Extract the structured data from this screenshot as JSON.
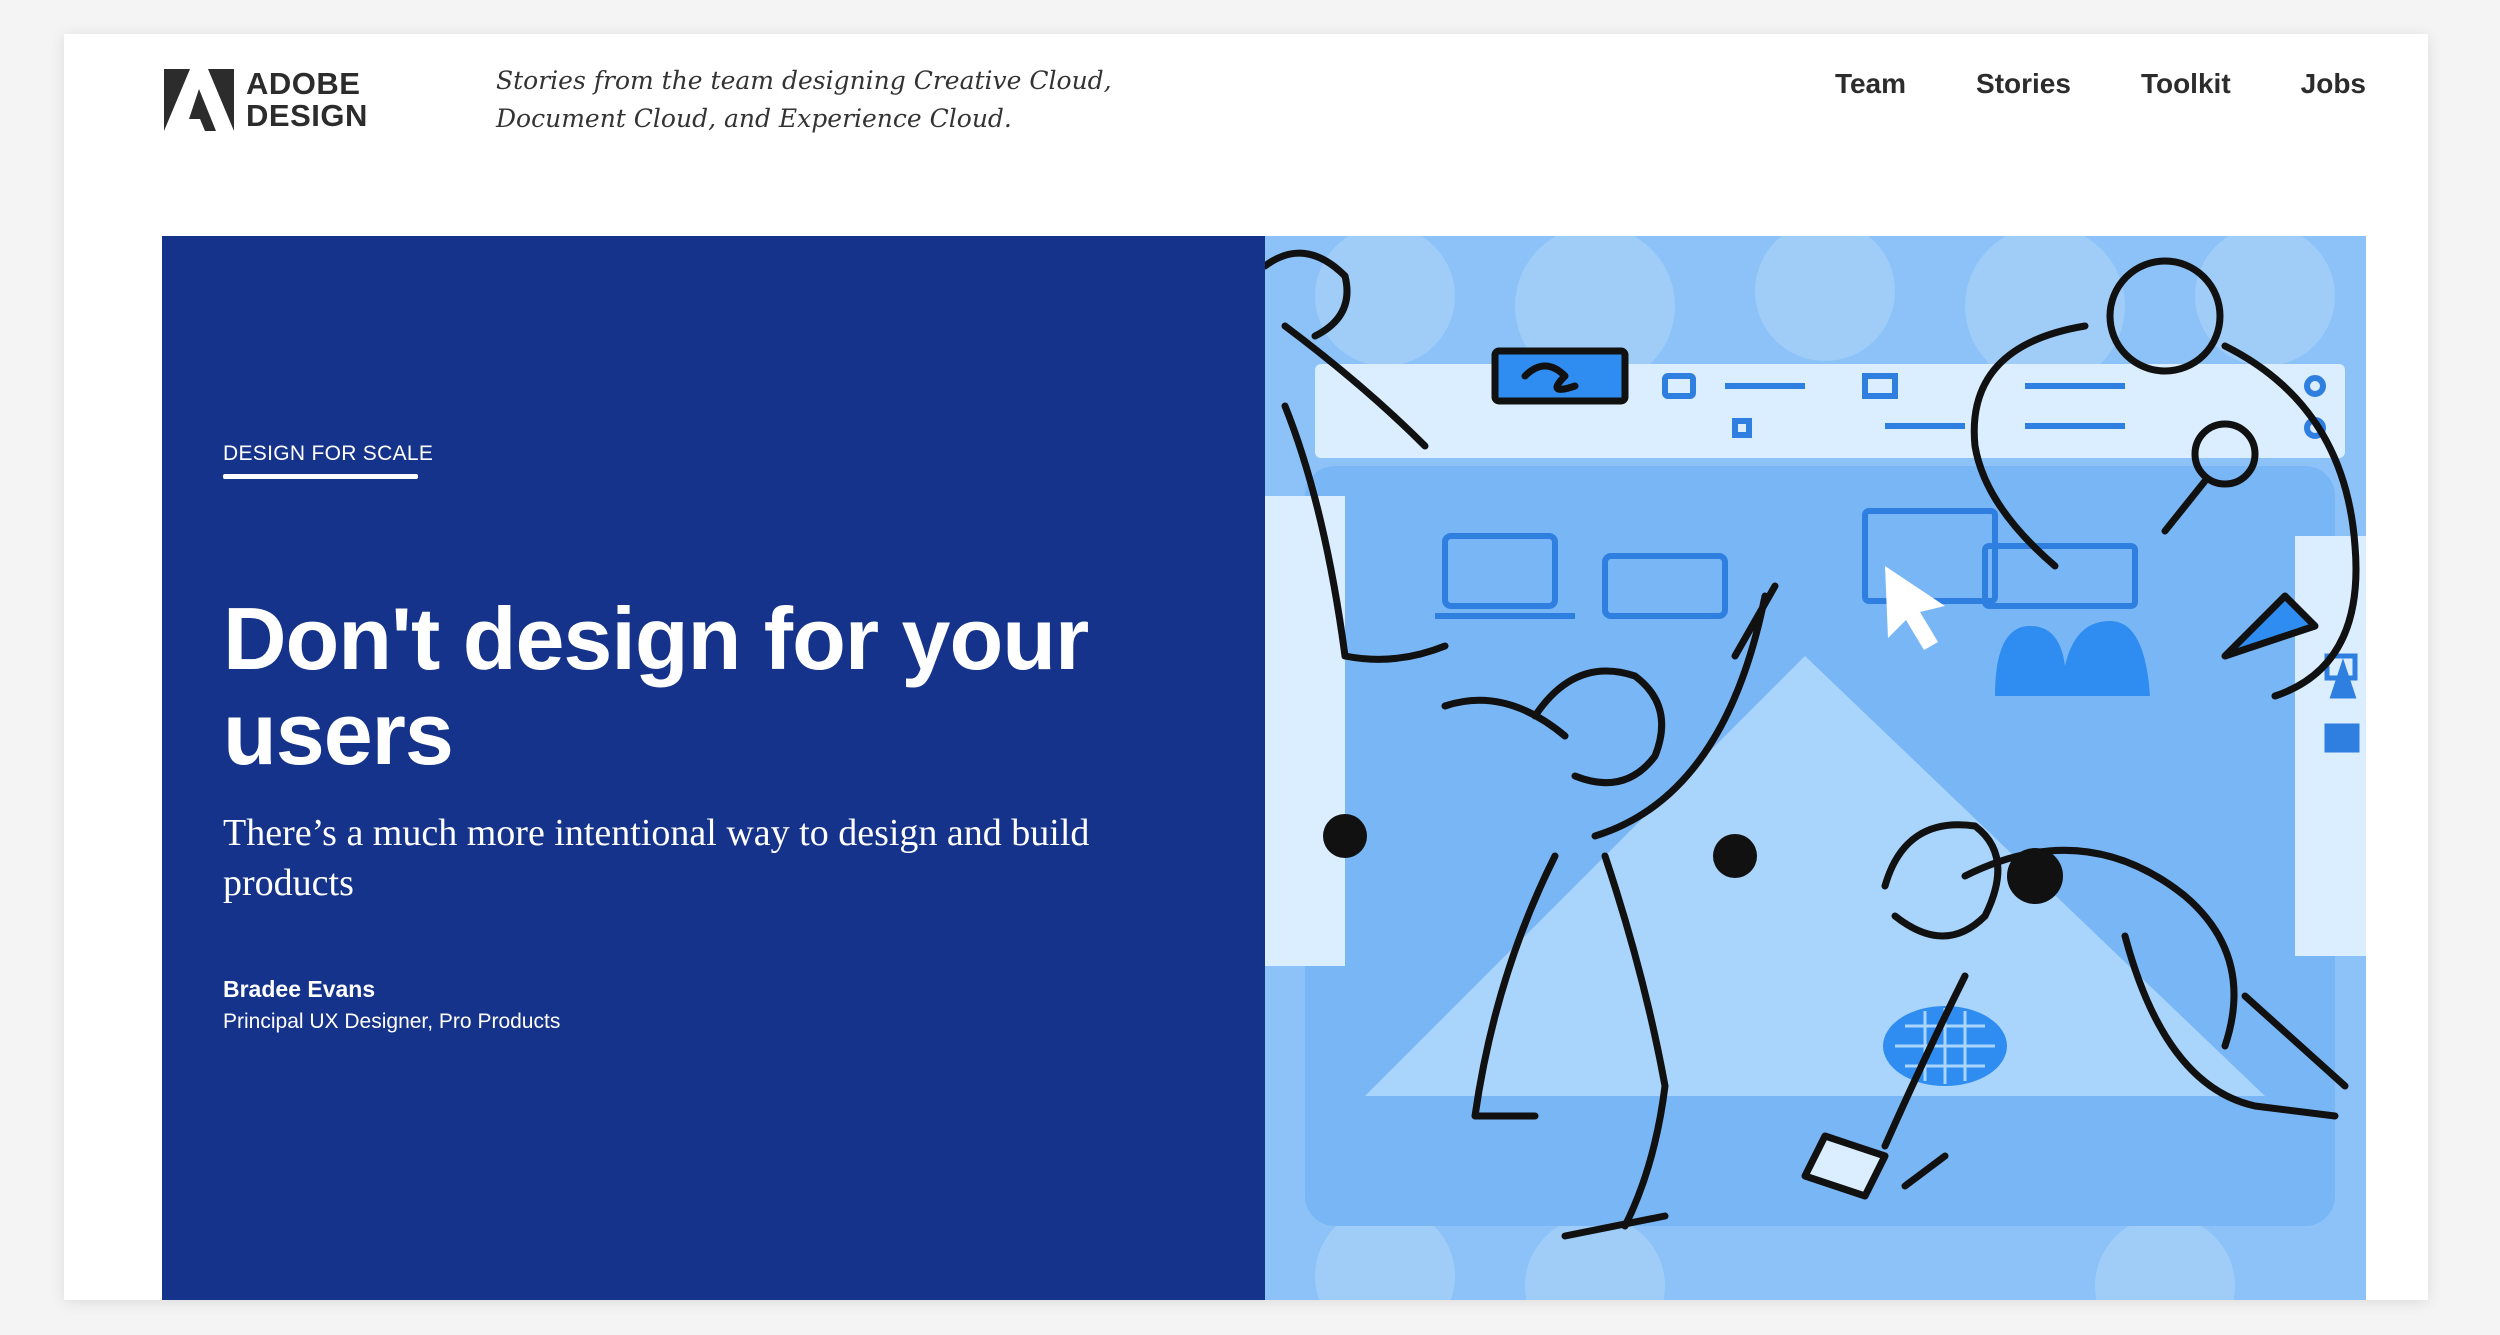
{
  "header": {
    "logo_text_line1": "ADOBE",
    "logo_text_line2": "DESIGN",
    "tagline_line1": "Stories from the team designing Creative Cloud,",
    "tagline_line2": "Document Cloud, and Experience Cloud.",
    "nav": [
      {
        "label": "Team"
      },
      {
        "label": "Stories"
      },
      {
        "label": "Toolkit"
      },
      {
        "label": "Jobs"
      }
    ]
  },
  "hero": {
    "kicker": "DESIGN FOR SCALE",
    "title": "Don't design for your users",
    "subtitle": "There’s a much more intentional way to design and build products",
    "author_name": "Bradee Evans",
    "author_role": "Principal UX Designer, Pro Products",
    "illustration_icon": "team-designing-illustration"
  },
  "colors": {
    "hero_bg": "#15338a",
    "illustration_bg": "#8cc2f7",
    "text_dark": "#2c2c2c",
    "accent_blue": "#2f8cf0"
  }
}
